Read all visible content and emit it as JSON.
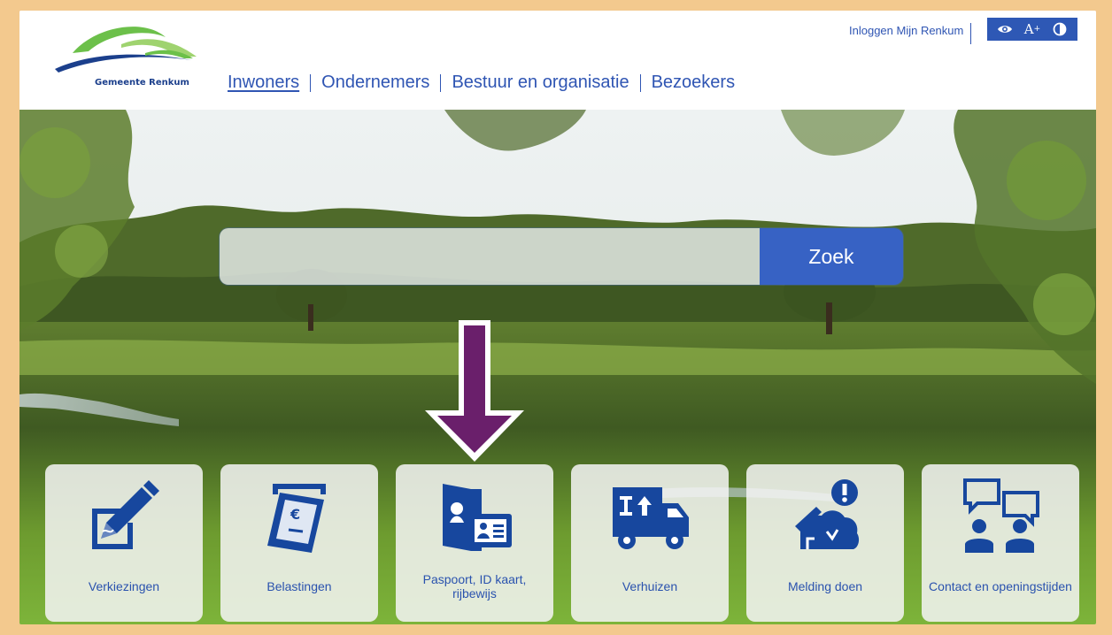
{
  "header": {
    "logo_text": "Gemeente Renkum",
    "nav": [
      {
        "label": "Inwoners",
        "active": true
      },
      {
        "label": "Ondernemers",
        "active": false
      },
      {
        "label": "Bestuur en organisatie",
        "active": false
      },
      {
        "label": "Bezoekers",
        "active": false
      }
    ],
    "login_label": "Inloggen Mijn Renkum",
    "tools": [
      "eye-icon",
      "text-size-icon",
      "contrast-icon"
    ],
    "text_size_label": "A",
    "text_size_sup": "+"
  },
  "search": {
    "placeholder": "",
    "value": "",
    "button_label": "Zoek"
  },
  "tiles": [
    {
      "label": "Verkiezingen",
      "icon": "ballot-pencil-icon"
    },
    {
      "label": "Belastingen",
      "icon": "tax-bill-icon"
    },
    {
      "label": "Paspoort, ID kaart, rijbewijs",
      "icon": "passport-id-icon"
    },
    {
      "label": "Verhuizen",
      "icon": "moving-truck-icon"
    },
    {
      "label": "Melding doen",
      "icon": "report-issue-icon"
    },
    {
      "label": "Contact en openingstijden",
      "icon": "contact-chat-icon"
    }
  ],
  "colors": {
    "brand_blue": "#2f55b3",
    "button_blue": "#3762c4",
    "icon_blue": "#17479e",
    "annotation_arrow": "#6a1f6b",
    "frame": "#f3c98e"
  }
}
